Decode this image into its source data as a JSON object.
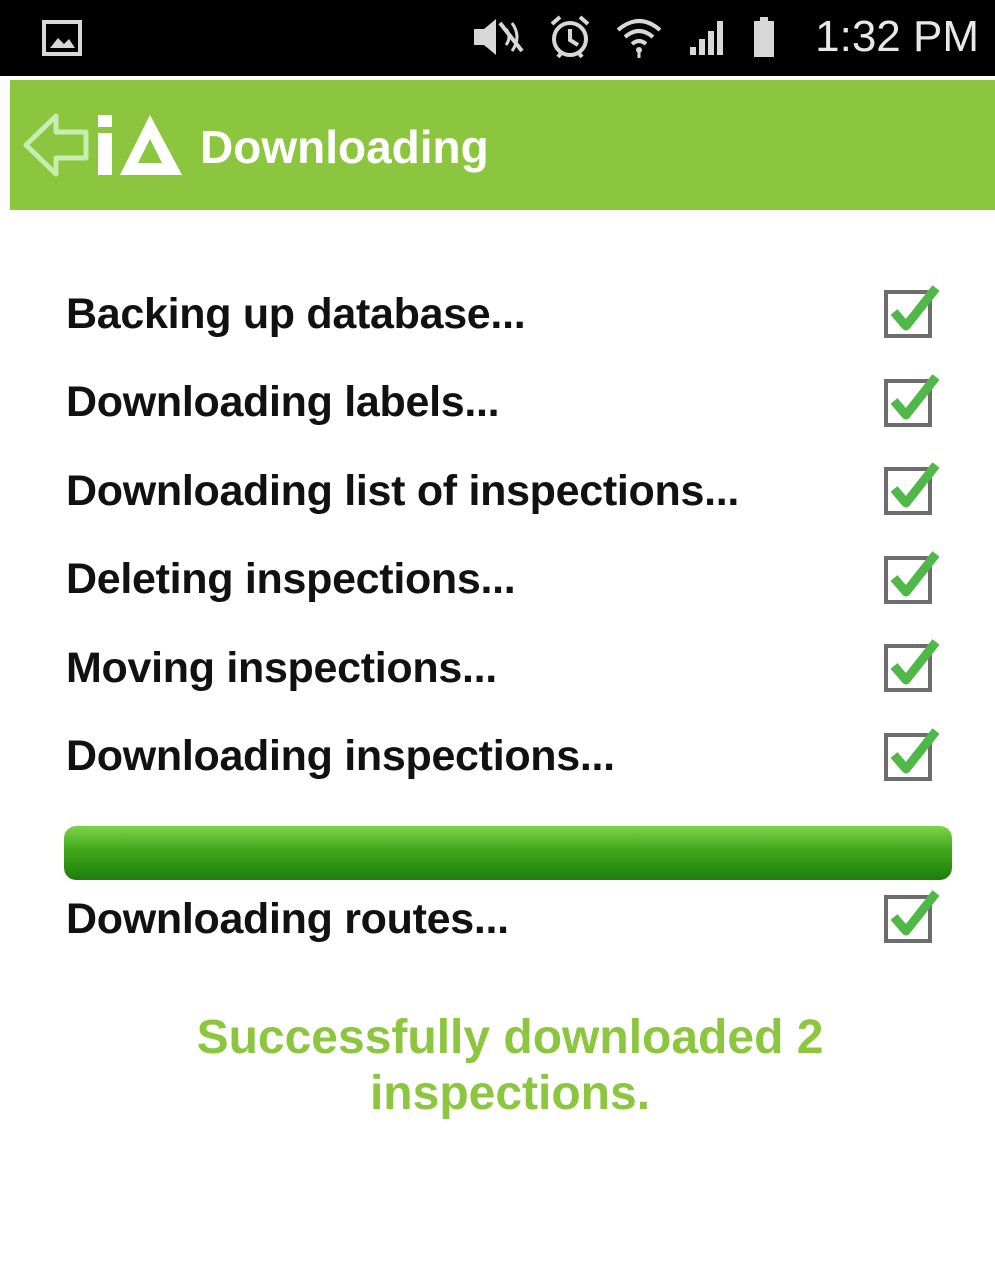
{
  "status_bar": {
    "time": "1:32 PM",
    "icons": [
      "gallery-icon",
      "mute-icon",
      "alarm-icon",
      "wifi-icon",
      "signal-icon",
      "battery-icon"
    ]
  },
  "app_bar": {
    "title": "Downloading",
    "background_color": "#8cc63f",
    "icons": [
      "back-arrow-icon",
      "ia-logo-icon"
    ]
  },
  "tasks": [
    {
      "label": "Backing up database...",
      "done": true
    },
    {
      "label": "Downloading labels...",
      "done": true
    },
    {
      "label": "Downloading list of inspections...",
      "done": true
    },
    {
      "label": "Deleting inspections...",
      "done": true
    },
    {
      "label": "Moving inspections...",
      "done": true
    },
    {
      "label": "Downloading inspections...",
      "done": true
    }
  ],
  "progress": {
    "percent": 100,
    "color": "#2e9a14"
  },
  "routes_task": {
    "label": "Downloading routes...",
    "done": true
  },
  "result": {
    "message": "Successfully downloaded 2 inspections.",
    "color": "#8cc63f"
  }
}
